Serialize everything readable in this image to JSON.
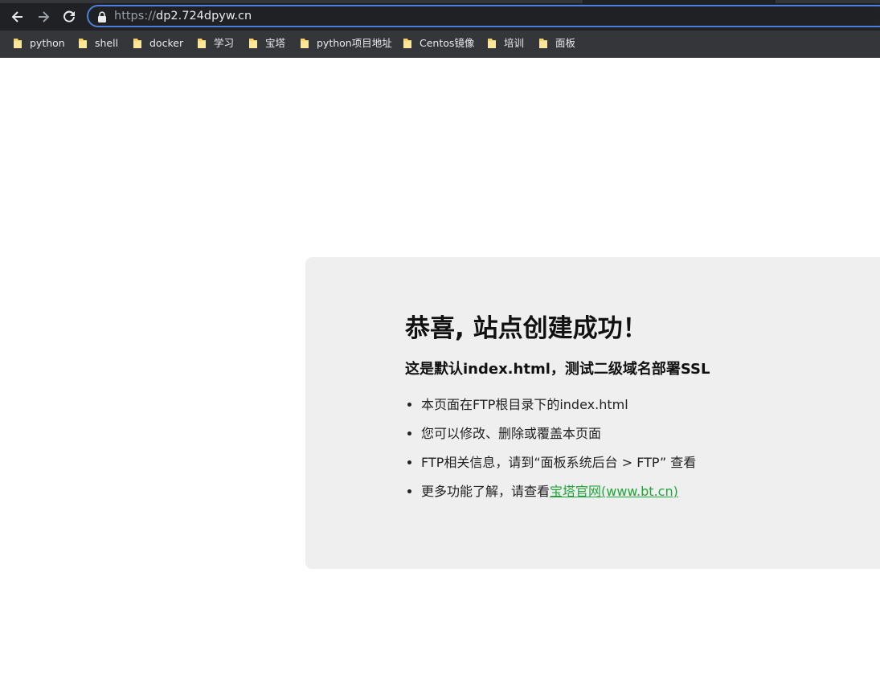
{
  "browser": {
    "url": {
      "scheme": "https://",
      "host": "dp2.724dpyw.cn"
    },
    "nav": {
      "back_icon": "arrow-left-icon",
      "forward_icon": "arrow-right-icon",
      "reload_icon": "reload-icon",
      "lock_icon": "lock-icon"
    },
    "bookmarks": [
      {
        "label": "python",
        "icon": "folder-icon"
      },
      {
        "label": "shell",
        "icon": "folder-icon"
      },
      {
        "label": "docker",
        "icon": "folder-icon"
      },
      {
        "label": "学习",
        "icon": "folder-icon"
      },
      {
        "label": "宝塔",
        "icon": "folder-icon"
      },
      {
        "label": "python项目地址",
        "icon": "folder-icon"
      },
      {
        "label": "Centos镜像",
        "icon": "folder-icon"
      },
      {
        "label": "培训",
        "icon": "folder-icon"
      },
      {
        "label": "面板",
        "icon": "folder-icon"
      }
    ],
    "colors": {
      "toolbar_bg": "#202124",
      "bookmarks_bg": "#35363a",
      "omnibox_border": "#4e7fd9",
      "folder_yellow": "#f6d365"
    }
  },
  "page": {
    "headline": "恭喜, 站点创建成功！",
    "subheadline": "这是默认index.html，测试二级域名部署SSL",
    "items": [
      {
        "text": "本页面在FTP根目录下的index.html"
      },
      {
        "text": "您可以修改、删除或覆盖本页面"
      },
      {
        "text": "FTP相关信息，请到“面板系统后台 > FTP” 查看"
      },
      {
        "text": "更多功能了解，请查看",
        "link": "宝塔官网(www.bt.cn)"
      }
    ],
    "colors": {
      "card_bg": "#efefef",
      "link": "#20a53a"
    }
  }
}
